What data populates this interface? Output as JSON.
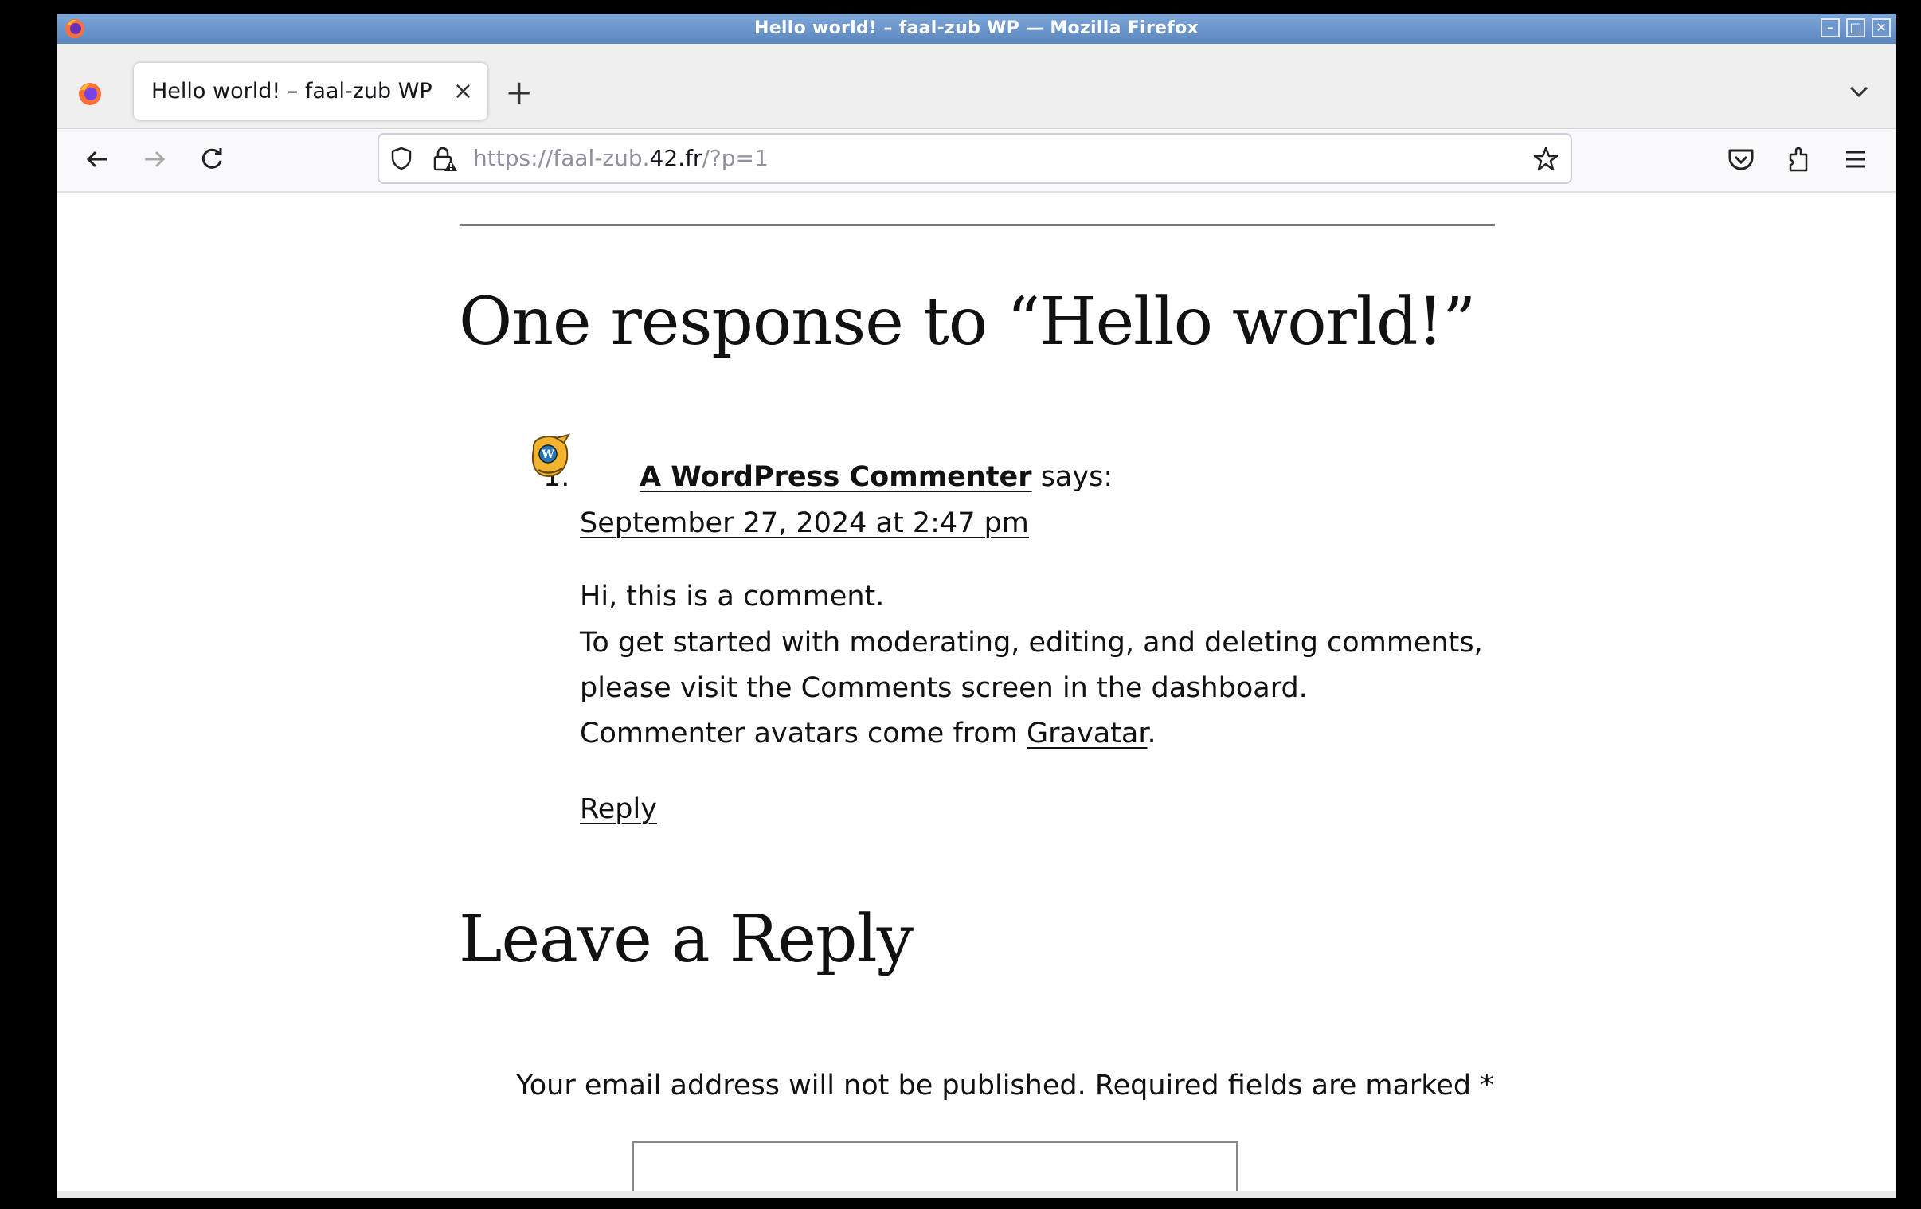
{
  "window": {
    "title": "Hello world! – faal-zub WP — Mozilla Firefox",
    "controls": [
      "minimize",
      "maximize",
      "close"
    ]
  },
  "tabs": [
    {
      "label": "Hello world! – faal-zub WP",
      "active": true
    }
  ],
  "toolbar": {
    "url_prefix": "https://faal-zub.",
    "url_domain": "42.fr",
    "url_suffix": "/?p=1",
    "icons": [
      "back-icon",
      "forward-icon",
      "reload-icon",
      "shield-icon",
      "lock-warning-icon",
      "star-icon",
      "pocket-icon",
      "extensions-icon",
      "menu-icon"
    ]
  },
  "page": {
    "comments_heading": "One response to “Hello world!”",
    "comment": {
      "number": "1.",
      "author": "A WordPress Commenter",
      "says": "says:",
      "date": "September 27, 2024 at 2:47 pm",
      "line1": "Hi, this is a comment.",
      "line2": "To get started with moderating, editing, and deleting comments,",
      "line3": "please visit the Comments screen in the dashboard.",
      "line4_prefix": "Commenter avatars come from ",
      "line4_link": "Gravatar",
      "line4_suffix": ".",
      "reply": "Reply"
    },
    "reply_heading": "Leave a Reply",
    "notice": "Your email address will not be published. Required fields are marked *"
  },
  "colors": {
    "titlebar": "#6b96cc",
    "text": "#111111",
    "tabstrip": "#efefef"
  }
}
